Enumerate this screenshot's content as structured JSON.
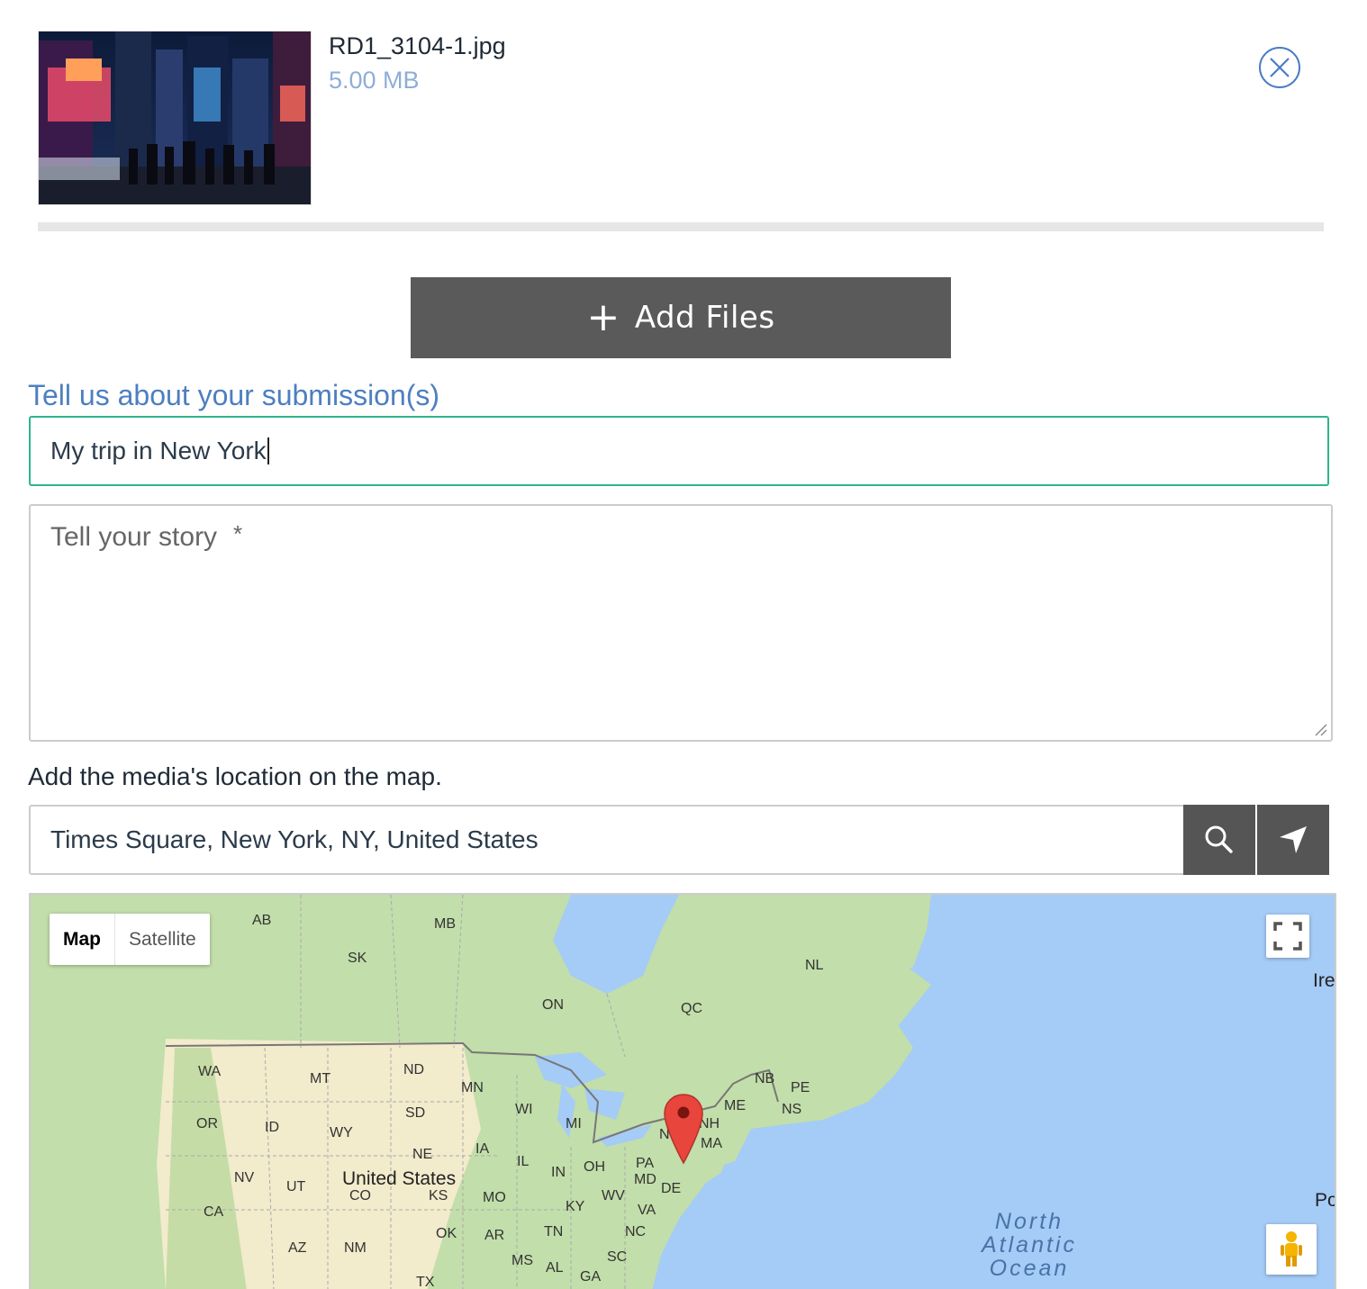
{
  "upload": {
    "file_name": "RD1_3104-1.jpg",
    "file_size": "5.00 MB",
    "progress": 1.0
  },
  "add_files": {
    "label": "Add Files"
  },
  "submission": {
    "section_title": "Tell us about your submission(s)",
    "title_value": "My trip in New York",
    "story_placeholder": "Tell your story",
    "story_required_mark": "*",
    "story_value": ""
  },
  "location": {
    "label": "Add the media's location on the map.",
    "value": "Times Square, New York, NY, United States"
  },
  "map": {
    "type_buttons": [
      "Map",
      "Satellite"
    ],
    "active_type": "Map",
    "country_label": "United States",
    "ocean_label": [
      "North",
      "Atlantic",
      "Ocean"
    ],
    "edge_labels": [
      "Ire",
      "Po"
    ],
    "region_labels": [
      "AB",
      "MB",
      "SK",
      "NL",
      "ON",
      "QC",
      "WA",
      "MT",
      "ND",
      "MN",
      "NB",
      "PE",
      "NS",
      "ME",
      "OR",
      "ID",
      "SD",
      "WI",
      "MI",
      "NH",
      "NY",
      "WY",
      "NE",
      "IA",
      "MA",
      "IL",
      "IN",
      "OH",
      "PA",
      "NV",
      "UT",
      "CO",
      "KS",
      "MO",
      "MD",
      "DE",
      "WV",
      "KY",
      "VA",
      "CA",
      "OK",
      "AR",
      "TN",
      "NC",
      "AZ",
      "NM",
      "MS",
      "AL",
      "GA",
      "SC",
      "TX"
    ],
    "colors": {
      "water": "#a5cbf7",
      "land": "#c2deaa",
      "dry": "#f2ebcc",
      "marker": "#e8453c"
    }
  }
}
